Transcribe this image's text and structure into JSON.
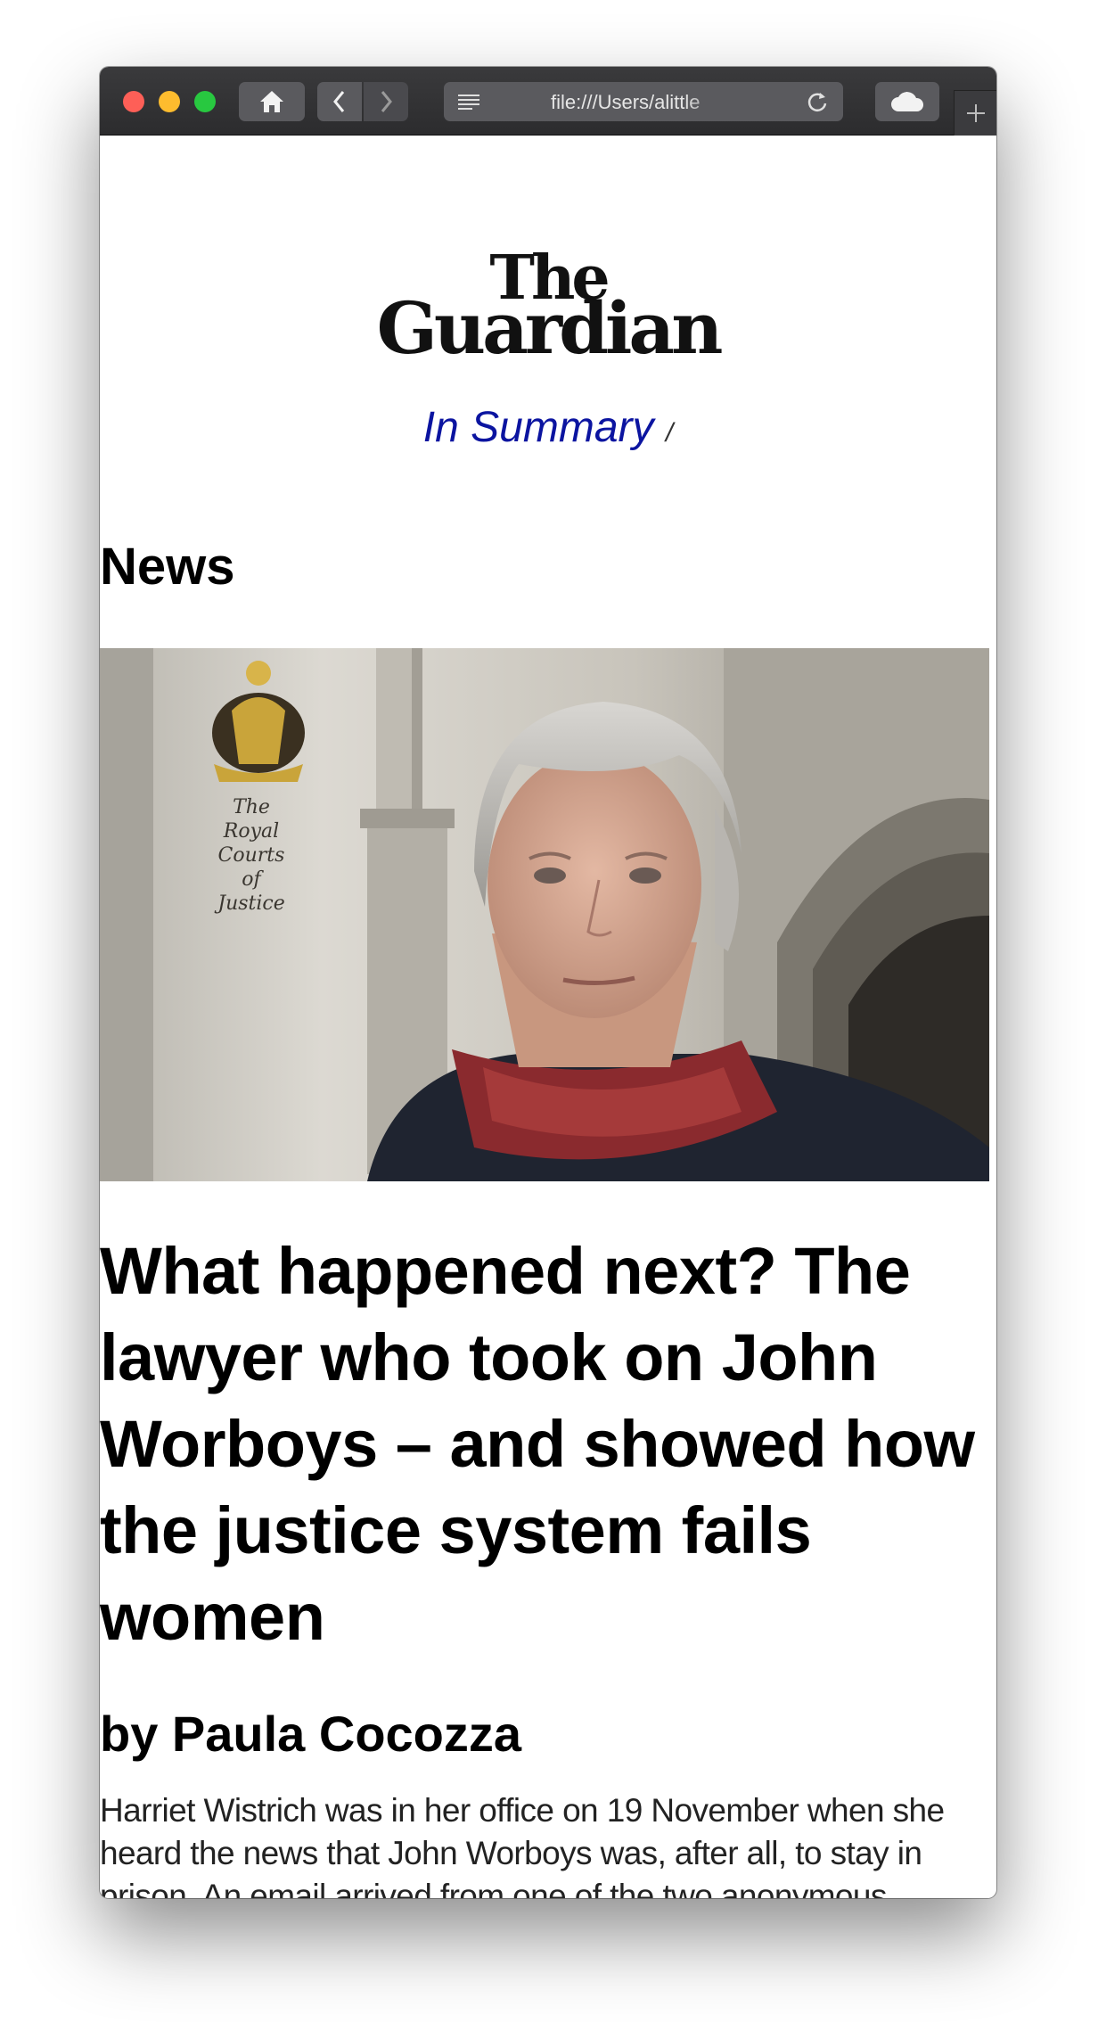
{
  "browser": {
    "url": "file:///Users/alittle",
    "buttons": {
      "home_icon": "home-icon",
      "back_icon": "chevron-left-icon",
      "forward_icon": "chevron-right-icon",
      "reader_icon": "reader-icon",
      "reload_icon": "reload-icon",
      "cloud_icon": "cloud-icon",
      "new_tab_icon": "plus-icon"
    }
  },
  "masthead": {
    "logo_line1": "The",
    "logo_line2": "Guardian",
    "summary_link": "In Summary",
    "summary_sep": "/"
  },
  "section": "News",
  "hero_image": {
    "sign_lines": [
      "The",
      "Royal",
      "Courts",
      "of",
      "Justice"
    ]
  },
  "article": {
    "headline": "What happened next? The lawyer who took on John Worboys – and showed how the justice system fails women",
    "byline": "by Paula Cocozza",
    "body": "Harriet Wistrich was in her office on 19 November when she heard the news that John Worboys was, after all, to stay in prison. An email arrived from one of the two anonymous"
  },
  "colors": {
    "link": "#0b14a0",
    "titlebar": "#2c2c2e"
  }
}
